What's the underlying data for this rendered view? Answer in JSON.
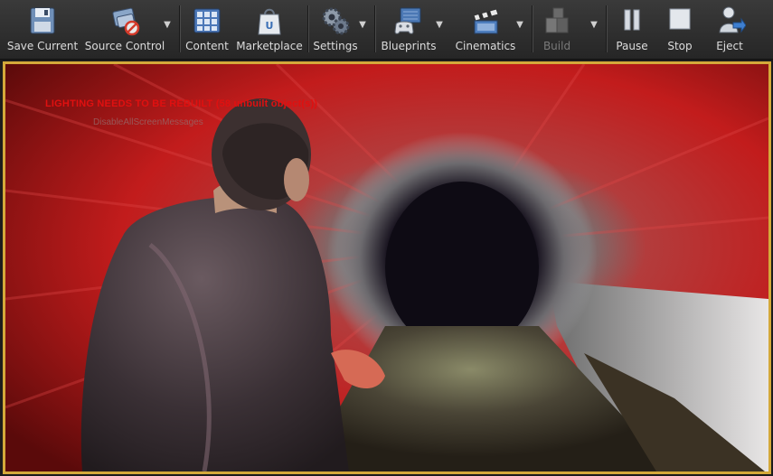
{
  "toolbar": {
    "buttons": [
      {
        "label": "Save Current",
        "icon": "floppy-disk-icon"
      },
      {
        "label": "Source Control",
        "icon": "source-control-icon"
      },
      {
        "label": "Content",
        "icon": "content-grid-icon"
      },
      {
        "label": "Marketplace",
        "icon": "marketplace-bag-icon"
      },
      {
        "label": "Settings",
        "icon": "settings-gears-icon"
      },
      {
        "label": "Blueprints",
        "icon": "blueprints-gamepad-icon"
      },
      {
        "label": "Cinematics",
        "icon": "clapperboard-icon"
      },
      {
        "label": "Build",
        "icon": "build-blocks-icon",
        "state": "disabled"
      },
      {
        "label": "Pause",
        "icon": "pause-icon"
      },
      {
        "label": "Stop",
        "icon": "stop-icon"
      },
      {
        "label": "Eject",
        "icon": "eject-person-icon"
      }
    ]
  },
  "viewport": {
    "warning": "LIGHTING NEEDS TO BE REBUILT (58 unbuilt object(s))",
    "subwarning": "DisableAllScreenMessages",
    "colors": {
      "border": "#d4a93a",
      "warning": "#e01010"
    }
  }
}
